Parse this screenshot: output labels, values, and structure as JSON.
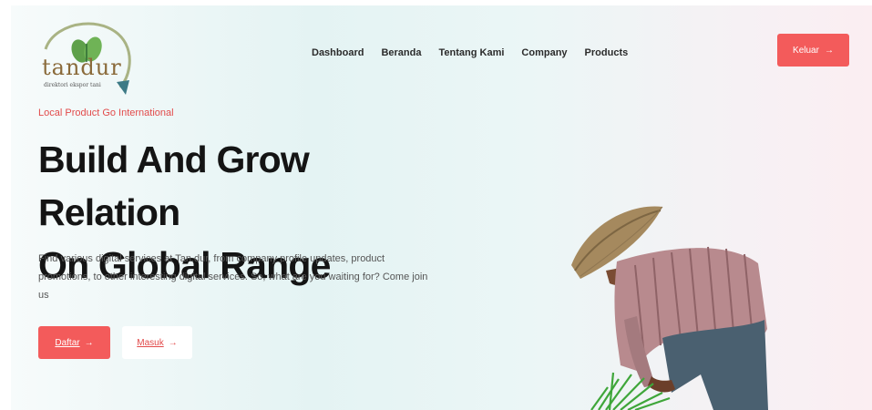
{
  "brand": {
    "name": "tandur",
    "tagline": "direktori ekspor tani"
  },
  "nav": {
    "items": [
      {
        "label": "Dashboard"
      },
      {
        "label": "Beranda"
      },
      {
        "label": "Tentang Kami"
      },
      {
        "label": "Company"
      },
      {
        "label": "Products"
      }
    ]
  },
  "header": {
    "logout_label": "Keluar",
    "logout_arrow": "→"
  },
  "hero": {
    "eyebrow": "Local Product Go International",
    "headline_line1": "Build And Grow Relation",
    "headline_line2": "On Global Range",
    "description": "Find various digital services at Tan.dur, from company profile updates, product promotions, to other interesting digital services. So, what are you waiting for? Come join us",
    "register_label": "Daftar",
    "login_label": "Masuk",
    "arrow": "→"
  },
  "colors": {
    "accent": "#f35b5b",
    "accent_text": "#e24b4b",
    "heading": "#141414"
  }
}
